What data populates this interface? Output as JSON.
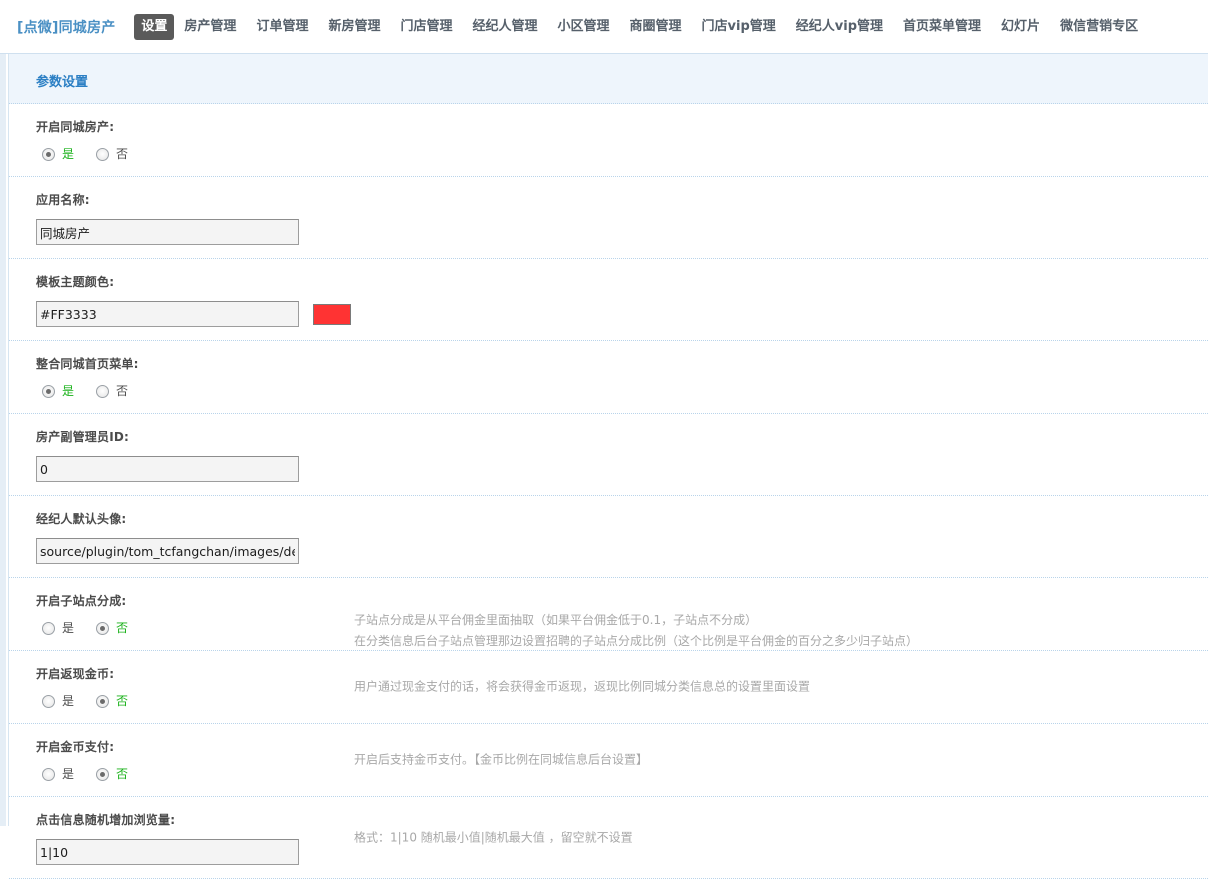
{
  "nav": {
    "brand": "[点微]同城房产",
    "items": [
      {
        "label": "设置",
        "active": true
      },
      {
        "label": "房产管理",
        "active": false
      },
      {
        "label": "订单管理",
        "active": false
      },
      {
        "label": "新房管理",
        "active": false
      },
      {
        "label": "门店管理",
        "active": false
      },
      {
        "label": "经纪人管理",
        "active": false
      },
      {
        "label": "小区管理",
        "active": false
      },
      {
        "label": "商圈管理",
        "active": false
      },
      {
        "label": "门店vip管理",
        "active": false
      },
      {
        "label": "经纪人vip管理",
        "active": false
      },
      {
        "label": "首页菜单管理",
        "active": false
      },
      {
        "label": "幻灯片",
        "active": false
      },
      {
        "label": "微信营销专区",
        "active": false
      }
    ]
  },
  "panel": {
    "title": "参数设置"
  },
  "options": {
    "yes": "是",
    "no": "否"
  },
  "colors": {
    "theme_swatch": "#FF3333",
    "selected_label": "#19b119",
    "panel_title": "#2b7fc4",
    "active_tab_bg": "#5a5a5a"
  },
  "rows": [
    {
      "label": "开启同城房产:",
      "type": "radio",
      "selected": "yes",
      "tip": ""
    },
    {
      "label": "应用名称:",
      "type": "text",
      "value": "同城房产",
      "placeholder": "",
      "tip": ""
    },
    {
      "label": "模板主题颜色:",
      "type": "color",
      "value": "#FF3333",
      "placeholder": "",
      "swatch": "#FF3333",
      "tip": ""
    },
    {
      "label": "整合同城首页菜单:",
      "type": "radio",
      "selected": "yes",
      "tip": ""
    },
    {
      "label": "房产副管理员ID:",
      "type": "text",
      "value": "0",
      "placeholder": "",
      "tip": ""
    },
    {
      "label": "经纪人默认头像:",
      "type": "text",
      "value": "source/plugin/tom_tcfangchan/images/de",
      "placeholder": "",
      "tip": ""
    },
    {
      "label": "开启子站点分成:",
      "type": "radio",
      "selected": "no",
      "tip_line1": "子站点分成是从平台佣金里面抽取（如果平台佣金低于0.1，子站点不分成）",
      "tip_line2": "在分类信息后台子站点管理那边设置招聘的子站点分成比例（这个比例是平台佣金的百分之多少归子站点）"
    },
    {
      "label": "开启返现金币:",
      "type": "radio",
      "selected": "no",
      "tip": "用户通过现金支付的话，将会获得金币返现，返现比例同城分类信息总的设置里面设置"
    },
    {
      "label": "开启金币支付:",
      "type": "radio",
      "selected": "no",
      "tip": "开启后支持金币支付。【金币比例在同城信息后台设置】"
    },
    {
      "label": "点击信息随机增加浏览量:",
      "type": "text",
      "value": "1|10",
      "placeholder": "",
      "tip": "格式：1|10 随机最小值|随机最大值 ，留空就不设置"
    }
  ]
}
